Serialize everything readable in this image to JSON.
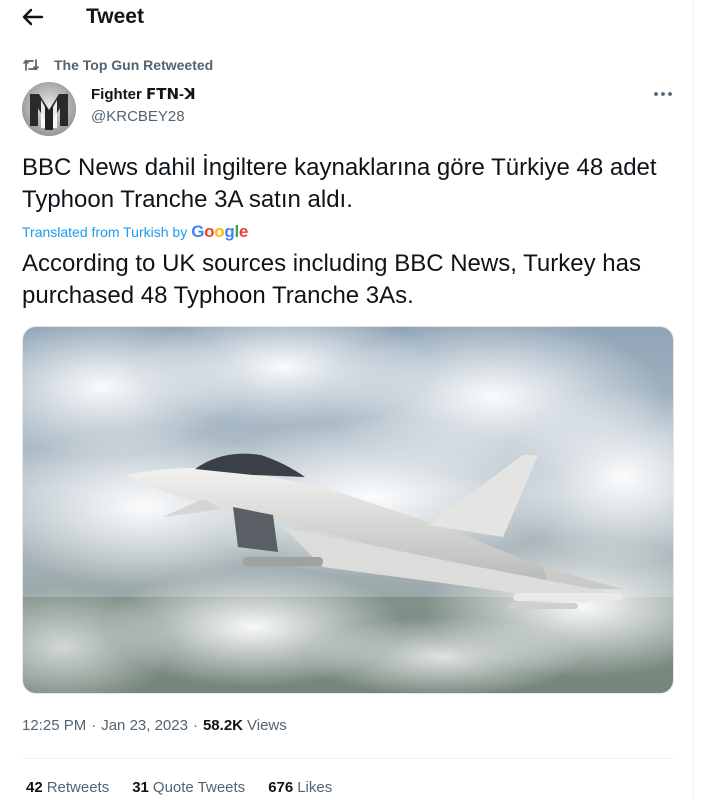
{
  "header": {
    "title": "Tweet"
  },
  "retweet": {
    "text": "The Top Gun Retweeted"
  },
  "author": {
    "name": "Fighter ꓝꓔꓠ‑ꓘ",
    "handle": "@KRCBEY28"
  },
  "tweet": {
    "text": "BBC News dahil İngiltere kaynaklarına göre Türkiye 48 adet Typhoon Tranche 3A satın aldı.",
    "translated_label": "Translated from Turkish by",
    "translated_provider": "Google",
    "translation": "According to UK sources including BBC News, Turkey has purchased 48 Typhoon Tranche 3As."
  },
  "meta": {
    "time": "12:25 PM",
    "date": "Jan 23, 2023",
    "views_count": "58.2K",
    "views_label": "Views"
  },
  "stats": {
    "retweets_count": "42",
    "retweets_label": "Retweets",
    "quotes_count": "31",
    "quotes_label": "Quote Tweets",
    "likes_count": "676",
    "likes_label": "Likes"
  },
  "icons": {
    "back": "arrow-left-icon",
    "retweet": "retweet-icon",
    "more": "more-horizontal-icon"
  },
  "colors": {
    "accent": "#1d9bf0",
    "secondary_text": "#536471",
    "primary_text": "#0f1419"
  }
}
